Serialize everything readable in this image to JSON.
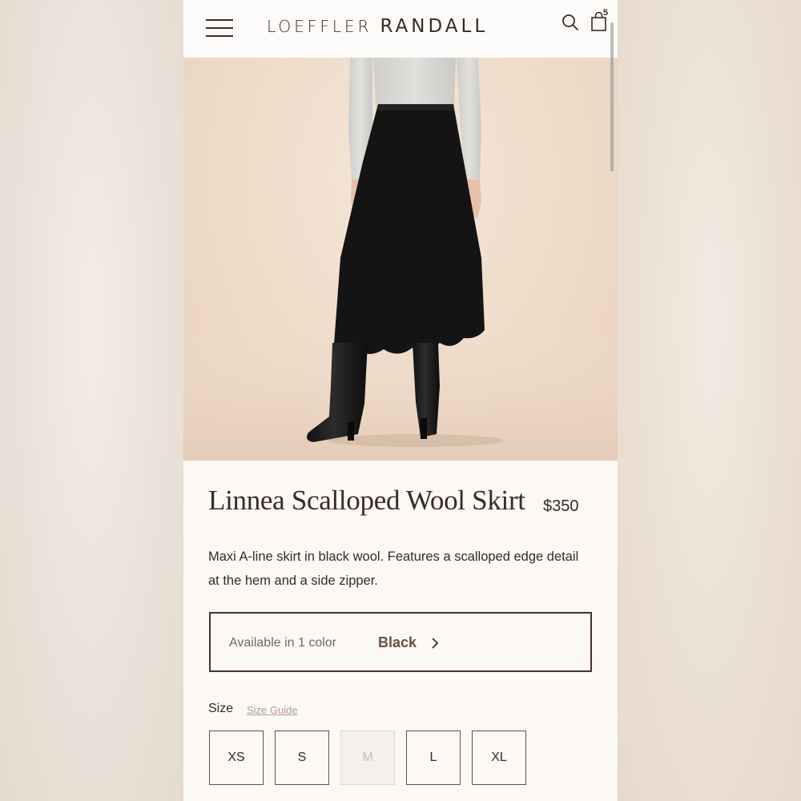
{
  "header": {
    "brand_part1": "LOEFFLER",
    "brand_part2": "RANDALL",
    "cart_count": "5",
    "icons": [
      "menu-icon",
      "search-icon",
      "shopping-bag-icon"
    ]
  },
  "product": {
    "title": "Linnea Scalloped Wool Skirt",
    "price": "$350",
    "description": "Maxi A-line skirt in black wool. Features a scalloped edge detail at the hem and a side zipper."
  },
  "color_selector": {
    "available_text": "Available in 1 color",
    "selected_color": "Black"
  },
  "sizes": {
    "label": "Size",
    "guide_link": "Size Guide",
    "options": [
      {
        "label": "XS",
        "available": true
      },
      {
        "label": "S",
        "available": true
      },
      {
        "label": "M",
        "available": false
      },
      {
        "label": "L",
        "available": true
      },
      {
        "label": "XL",
        "available": true
      }
    ]
  },
  "colors": {
    "text_primary": "#3a2a22",
    "accent_brown": "#6b4f42",
    "page_bg": "#fbf8f5"
  }
}
